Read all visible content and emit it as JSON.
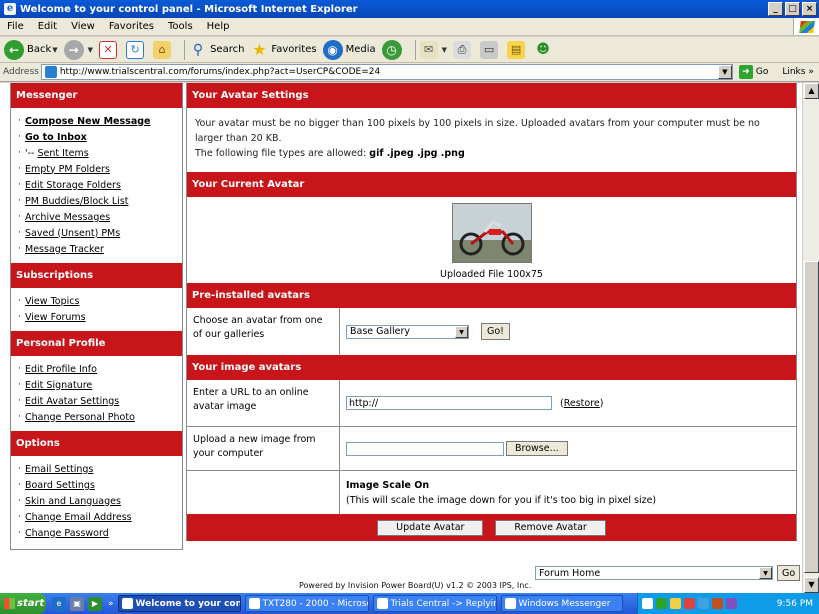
{
  "window": {
    "title": "Welcome to your control panel - Microsoft Internet Explorer"
  },
  "menu": [
    "File",
    "Edit",
    "View",
    "Favorites",
    "Tools",
    "Help"
  ],
  "toolbar": {
    "back": "Back",
    "search": "Search",
    "favorites": "Favorites",
    "media": "Media"
  },
  "address": {
    "label": "Address",
    "url": "http://www.trialscentral.com/forums/index.php?act=UserCP&CODE=24",
    "go": "Go",
    "links": "Links"
  },
  "sidebar": {
    "sections": [
      {
        "title": "Messenger",
        "items": [
          {
            "label": "Compose New Message",
            "bold": true
          },
          {
            "label": "Go to Inbox",
            "bold": true
          },
          {
            "label": "Sent Items",
            "prefix": "'--"
          },
          {
            "label": "Empty PM Folders"
          },
          {
            "label": "Edit Storage Folders"
          },
          {
            "label": "PM Buddies/Block List"
          },
          {
            "label": "Archive Messages"
          },
          {
            "label": "Saved (Unsent) PMs"
          },
          {
            "label": "Message Tracker"
          }
        ]
      },
      {
        "title": "Subscriptions",
        "items": [
          {
            "label": "View Topics"
          },
          {
            "label": "View Forums"
          }
        ]
      },
      {
        "title": "Personal Profile",
        "items": [
          {
            "label": "Edit Profile Info"
          },
          {
            "label": "Edit Signature"
          },
          {
            "label": "Edit Avatar Settings"
          },
          {
            "label": "Change Personal Photo"
          }
        ]
      },
      {
        "title": "Options",
        "items": [
          {
            "label": "Email Settings"
          },
          {
            "label": "Board Settings"
          },
          {
            "label": "Skin and Languages"
          },
          {
            "label": "Change Email Address"
          },
          {
            "label": "Change Password"
          }
        ]
      }
    ]
  },
  "main": {
    "settings_title": "Your Avatar Settings",
    "settings_text": "Your avatar must be no bigger than 100 pixels by 100 pixels in size. Uploaded avatars from your computer must be no larger than 20 KB.",
    "filetypes_prefix": "The following file types are allowed:",
    "filetypes": "gif .jpeg .jpg .png",
    "current_title": "Your Current Avatar",
    "avatar_caption": "Uploaded File 100x75",
    "preinstalled_title": "Pre-installed avatars",
    "gallery_label": "Choose an avatar from one of our galleries",
    "gallery_selected": "Base Gallery",
    "gallery_go": "Go!",
    "image_title": "Your image avatars",
    "url_label": "Enter a URL to an online avatar image",
    "url_value": "http://",
    "restore": "Restore",
    "upload_label": "Upload a new image from your computer",
    "browse": "Browse...",
    "scale_title": "Image Scale On",
    "scale_text": "(This will scale the image down for you if it's too big in pixel size)",
    "update_btn": "Update Avatar",
    "remove_btn": "Remove Avatar"
  },
  "jump": {
    "selected": "Forum Home",
    "go": "Go"
  },
  "powered": "Powered by Invision Power Board(U) v1.2 © 2003  IPS, Inc.",
  "taskbar": {
    "start": "start",
    "tasks": [
      {
        "label": "Welcome to your con...",
        "active": true
      },
      {
        "label": "TXT280 - 2000 - Microso..."
      },
      {
        "label": "Trials Central -> Replyin..."
      },
      {
        "label": "Windows Messenger"
      }
    ],
    "clock": "9:56 PM"
  }
}
